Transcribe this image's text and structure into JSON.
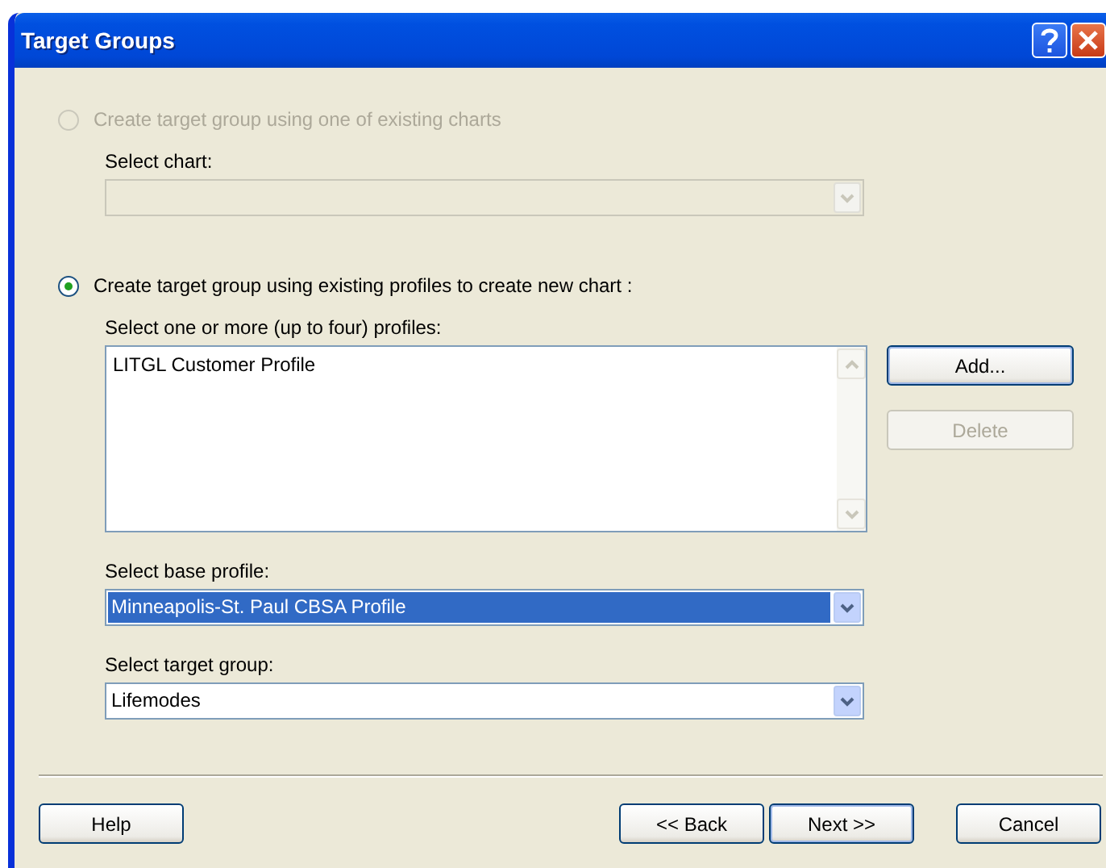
{
  "window": {
    "title": "Target Groups"
  },
  "options": [
    {
      "label": "Create target group using one of existing charts",
      "selected": false,
      "disabled": true,
      "fields": [
        {
          "kind": "combo",
          "label": "Select chart:",
          "disabled": true
        }
      ]
    },
    {
      "label": "Create target group using existing profiles to create new chart :",
      "selected": true,
      "disabled": false,
      "fields": [
        {
          "kind": "list",
          "label": "Select one or more (up to four) profiles:",
          "items": [
            "LITGL Customer Profile"
          ],
          "buttons": [
            {
              "label": "Add...",
              "disabled": false,
              "default": true
            },
            {
              "label": "Delete",
              "disabled": true,
              "default": false
            }
          ]
        },
        {
          "kind": "combo",
          "label": "Select base profile:",
          "value": "Minneapolis-St. Paul CBSA Profile",
          "disabled": false,
          "highlighted": true
        },
        {
          "kind": "combo",
          "label": "Select target group:",
          "value": "Lifemodes",
          "disabled": false,
          "highlighted": false
        }
      ]
    }
  ],
  "footer_buttons": [
    {
      "label": "Help",
      "default": false
    },
    {
      "label": "<< Back",
      "default": false
    },
    {
      "label": "Next >>",
      "default": true
    },
    {
      "label": "Cancel",
      "default": false
    }
  ]
}
